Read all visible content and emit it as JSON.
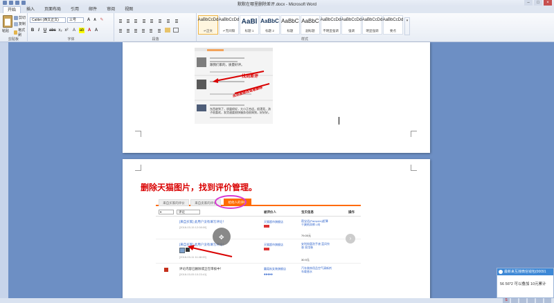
{
  "window": {
    "title": "默默在哪里删除差评.docx - Microsoft Word",
    "controls": [
      "–",
      "□",
      "×"
    ]
  },
  "menu_tabs": [
    "开始",
    "插入",
    "页面布局",
    "引用",
    "邮件",
    "审阅",
    "视图"
  ],
  "ribbon": {
    "clipboard": {
      "label": "剪贴板",
      "paste": "粘贴",
      "cut": "剪切",
      "copy": "复制",
      "format_painter": "格式刷"
    },
    "font": {
      "label": "字体",
      "font_name": "Calibri (西文正文)",
      "font_size": "三号",
      "bold": "B",
      "italic": "I",
      "underline": "U"
    },
    "paragraph": {
      "label": "段落"
    },
    "styles": {
      "label": "样式",
      "items": [
        {
          "sample": "AaBbCcDd",
          "name": "↵正文"
        },
        {
          "sample": "AaBbCcDd",
          "name": "↵无间隔"
        },
        {
          "sample": "AaBl",
          "name": "标题 1"
        },
        {
          "sample": "AaBbC",
          "name": "标题 2"
        },
        {
          "sample": "AaBbC",
          "name": "标题"
        },
        {
          "sample": "AaBbC",
          "name": "副标题"
        },
        {
          "sample": "AaBbCcDd",
          "name": "不明显强调"
        },
        {
          "sample": "AaBbCcDd",
          "name": "强调"
        },
        {
          "sample": "AaBbCcDd",
          "name": "明显强调"
        },
        {
          "sample": "AaBbCcDd",
          "name": "要点"
        }
      ]
    }
  },
  "page1_screenshot": {
    "annotation1": "找到差评",
    "annotation2": "点这里修改或者删除",
    "comment_text": [
      "跟我们家的，质量好评。",
      "东西收到了，质量很好，大小正合适，很漂亮，孩子很喜欢，发货速度很快服务也很周到，好好好。"
    ]
  },
  "page2": {
    "heading": "删除天猫图片，找到评价管理。",
    "shot_tabs": [
      "来自买家的评价",
      "来自卖家的评价",
      "给他人的评价"
    ],
    "filter_select": "评论",
    "column_headers": [
      "",
      "被评价人",
      "宝贝信息",
      "操作"
    ],
    "rows": [
      {
        "comment": "[来自买家] 此用户没有填写评论！",
        "date": "[2018-03-15 12:08:00]",
        "person": "天猫超市旗舰店",
        "item": "帮宝适(Pampers)超薄干爽纸尿裤 L码",
        "price": "79.00元"
      },
      {
        "comment": "[来自买家] 此用户没有填写评论！",
        "date": "[2018-03-11 11:48:00]",
        "person": "天猫超市旗舰店",
        "item": "安利抑菌洗手液 蓝风铃香 家用装",
        "price": "30.9元"
      },
      {
        "comment": "评论内容已删除或正在审核中！",
        "date": "[2018-03-05 10:23:41]",
        "person": "蘑菇街女装旗舰店",
        "item": "汽车装饰用品空气清新剂 车载香水",
        "price": ""
      }
    ]
  },
  "notification": {
    "title": "最新来互撞微信钱包(00091",
    "body": "56 56*2 可以叠加 10元累计"
  },
  "colors": {
    "accent": "#3d88d6",
    "annotation_red": "#d90000",
    "highlight_circle": "#d63ad2",
    "tab_orange": "#ff6a00"
  }
}
